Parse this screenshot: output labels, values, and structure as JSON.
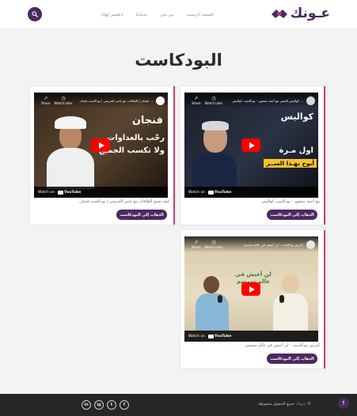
{
  "header": {
    "logo_text": "عـونك",
    "nav": [
      {
        "label": "الصفحة الرئيسية"
      },
      {
        "label": "من نحن"
      },
      {
        "label": "خدماتنا"
      },
      {
        "label": "قصص إلهام"
      }
    ],
    "nav_caret": "▾"
  },
  "page_title": "البودكاست",
  "cards": [
    {
      "video_title": "... كواليس الحصر مع أحمد منصور - بودكاست كواليس",
      "overlay_big": "كواليس",
      "overlay_line1": "اول مـرة",
      "overlay_line2": "أبوح بهـذا الســر",
      "watch_later": "Watch later",
      "share": "Share",
      "watch_on": "Watch on",
      "youtube": "YouTube",
      "caption": "مع أحمد منصور - بودكاست كواليس",
      "cta": "الذهاب إلى البودكاست"
    },
    {
      "video_title": "... فنجان | العلاقات مع ياسر الحزيمي | بودكاست فنجان",
      "overlay_big": "فنجان",
      "overlay_line1": "رحّب بالعداوات",
      "overlay_line2": "ولا تكسب الجميع",
      "watch_later": "Watch later",
      "share": "Share",
      "watch_on": "Watch on",
      "youtube": "YouTube",
      "caption": "كيف تجنح العلاقات مع ياسر الحزيمي | بودكاست فنجان",
      "cta": "الذهاب إلى البودكاست"
    },
    {
      "video_title": "كدرس بودكاست - لن أعيش في عالم سمسم",
      "overlay_big": "لن أعيش في عالم سمسم",
      "overlay_line1": "",
      "overlay_line2": "",
      "watch_later": "Watch later",
      "share": "Share",
      "watch_on": "Watch on",
      "youtube": "YouTube",
      "caption": "كدرس بودكاست - لن أعيش في عالم سمسم",
      "cta": "الذهاب إلى البودكاست"
    }
  ],
  "footer": {
    "copyright_brand": "عـونك",
    "copyright_text": "جميع الحقوق محفوظة",
    "socials": [
      "f",
      "t",
      "ig",
      "in"
    ],
    "totop": "↑"
  },
  "colors": {
    "brand": "#4a2a5e",
    "accent": "#c0437a"
  }
}
